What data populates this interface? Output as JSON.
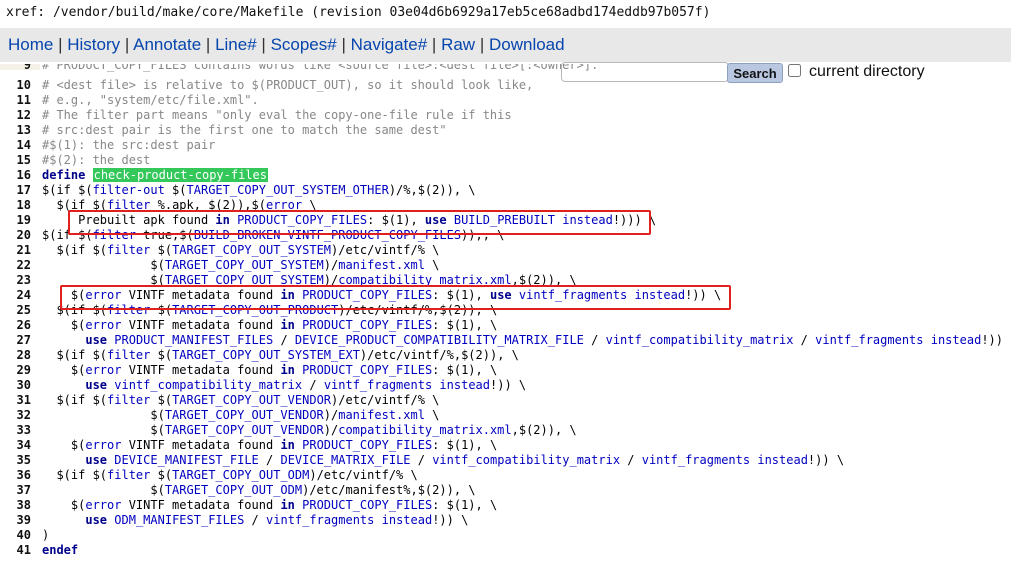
{
  "title": "xref: /vendor/build/make/core/Makefile (revision 03e04d6b6929a17eb5ce68adbd174eddb97b057f)",
  "nav": {
    "home": "Home",
    "history": "History",
    "annotate": "Annotate",
    "line": "Line#",
    "scopes": "Scopes#",
    "navigate": "Navigate#",
    "raw": "Raw",
    "download": "Download",
    "sep": "|"
  },
  "search": {
    "value": "",
    "button": "Search",
    "current_dir_label": "current directory"
  },
  "colors": {
    "highlight": "#34c759",
    "annotation_box": "#e0201c",
    "link": "#0645ad"
  },
  "code_lines": [
    {
      "n": "9",
      "t": "# PRODUCT_COPY_FILES contains words like <source file>:<dest file>[:<owner>]."
    },
    {
      "n": "10",
      "t": "# <dest file> is relative to $(PRODUCT_OUT), so it should look like,"
    },
    {
      "n": "11",
      "t": "# e.g., \"system/etc/file.xml\"."
    },
    {
      "n": "12",
      "t": "# The filter part means \"only eval the copy-one-file rule if this"
    },
    {
      "n": "13",
      "t": "# src:dest pair is the first one to match the same dest\""
    },
    {
      "n": "14",
      "t": "#$(1): the src:dest pair"
    },
    {
      "n": "15",
      "t": "#$(2): the dest"
    },
    {
      "n": "16",
      "t": "define check-product-copy-files"
    },
    {
      "n": "17",
      "t": "$(if $(filter-out $(TARGET_COPY_OUT_SYSTEM_OTHER)/%,$(2)), \\"
    },
    {
      "n": "18",
      "t": "  $(if $(filter %.apk, $(2)),$(error \\"
    },
    {
      "n": "19",
      "t": "     Prebuilt apk found in PRODUCT_COPY_FILES: $(1), use BUILD_PREBUILT instead!))) \\"
    },
    {
      "n": "20",
      "t": "$(if $(filter true,$(BUILD_BROKEN_VINTF_PRODUCT_COPY_FILES)),, \\"
    },
    {
      "n": "21",
      "t": "  $(if $(filter $(TARGET_COPY_OUT_SYSTEM)/etc/vintf/% \\"
    },
    {
      "n": "22",
      "t": "               $(TARGET_COPY_OUT_SYSTEM)/manifest.xml \\"
    },
    {
      "n": "23",
      "t": "               $(TARGET_COPY_OUT_SYSTEM)/compatibility_matrix.xml,$(2)), \\"
    },
    {
      "n": "24",
      "t": "    $(error VINTF metadata found in PRODUCT_COPY_FILES: $(1), use vintf_fragments instead!)) \\"
    },
    {
      "n": "25",
      "t": "  $(if $(filter $(TARGET_COPY_OUT_PRODUCT)/etc/vintf/%,$(2)), \\"
    },
    {
      "n": "26",
      "t": "    $(error VINTF metadata found in PRODUCT_COPY_FILES: $(1), \\"
    },
    {
      "n": "27",
      "t": "      use PRODUCT_MANIFEST_FILES / DEVICE_PRODUCT_COMPATIBILITY_MATRIX_FILE / vintf_compatibility_matrix / vintf_fragments instead!)) \\"
    },
    {
      "n": "28",
      "t": "  $(if $(filter $(TARGET_COPY_OUT_SYSTEM_EXT)/etc/vintf/%,$(2)), \\"
    },
    {
      "n": "29",
      "t": "    $(error VINTF metadata found in PRODUCT_COPY_FILES: $(1), \\"
    },
    {
      "n": "30",
      "t": "      use vintf_compatibility_matrix / vintf_fragments instead!)) \\"
    },
    {
      "n": "31",
      "t": "  $(if $(filter $(TARGET_COPY_OUT_VENDOR)/etc/vintf/% \\"
    },
    {
      "n": "32",
      "t": "               $(TARGET_COPY_OUT_VENDOR)/manifest.xml \\"
    },
    {
      "n": "33",
      "t": "               $(TARGET_COPY_OUT_VENDOR)/compatibility_matrix.xml,$(2)), \\"
    },
    {
      "n": "34",
      "t": "    $(error VINTF metadata found in PRODUCT_COPY_FILES: $(1), \\"
    },
    {
      "n": "35",
      "t": "      use DEVICE_MANIFEST_FILE / DEVICE_MATRIX_FILE / vintf_compatibility_matrix / vintf_fragments instead!)) \\"
    },
    {
      "n": "36",
      "t": "  $(if $(filter $(TARGET_COPY_OUT_ODM)/etc/vintf/% \\"
    },
    {
      "n": "37",
      "t": "               $(TARGET_COPY_OUT_ODM)/etc/manifest%,$(2)), \\"
    },
    {
      "n": "38",
      "t": "    $(error VINTF metadata found in PRODUCT_COPY_FILES: $(1), \\"
    },
    {
      "n": "39",
      "t": "      use ODM_MANIFEST_FILES / vintf_fragments instead!)) \\"
    },
    {
      "n": "40",
      "t": ")"
    },
    {
      "n": "41",
      "t": "endef"
    }
  ]
}
